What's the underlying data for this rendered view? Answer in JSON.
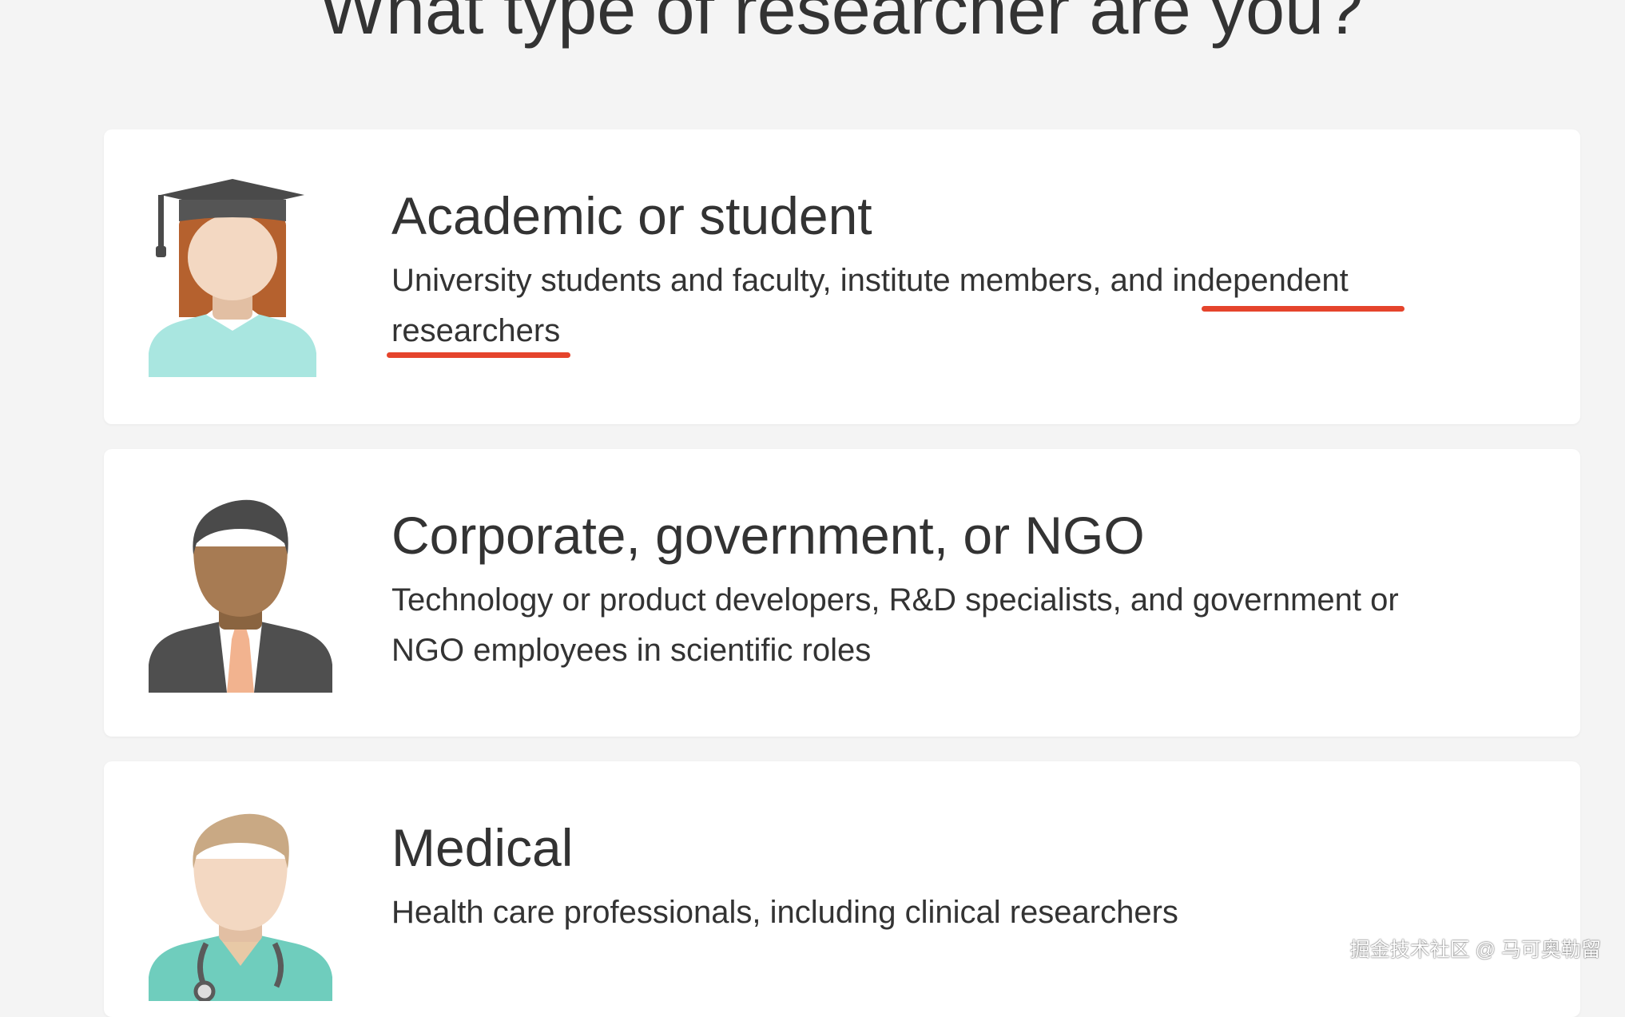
{
  "page": {
    "title": "What type of researcher are you?"
  },
  "options": [
    {
      "title": "Academic or student",
      "description": "University students and faculty, institute members, and independent researchers",
      "icon": "graduate-woman-icon"
    },
    {
      "title": "Corporate, government, or NGO",
      "description": "Technology or product developers, R&D specialists, and government or NGO employees in scientific roles",
      "icon": "businessman-icon"
    },
    {
      "title": "Medical",
      "description": "Health care professionals, including clinical researchers",
      "icon": "doctor-icon"
    }
  ],
  "annotations": {
    "underline_color": "#e5442c"
  },
  "watermark": {
    "text": "掘金技术社区 @ 马可奥勒留"
  }
}
